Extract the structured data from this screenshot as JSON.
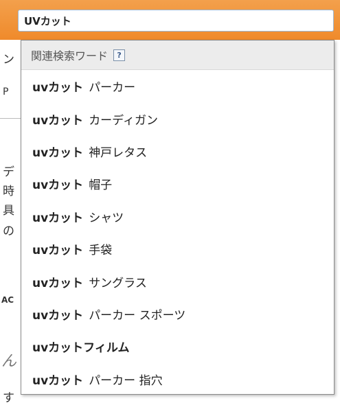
{
  "search": {
    "value": "UVカット"
  },
  "background_fragments": [
    "ン",
    "P",
    "デ",
    "時",
    "具",
    "の",
    "AC",
    "ん",
    "す"
  ],
  "dropdown": {
    "header_label": "関連検索ワード",
    "help_icon": "?",
    "items": [
      {
        "kw": "uvカット",
        "rest": "パーカー"
      },
      {
        "kw": "uvカット",
        "rest": "カーディガン"
      },
      {
        "kw": "uvカット",
        "rest": "神戸レタス"
      },
      {
        "kw": "uvカット",
        "rest": "帽子"
      },
      {
        "kw": "uvカット",
        "rest": "シャツ"
      },
      {
        "kw": "uvカット",
        "rest": "手袋"
      },
      {
        "kw": "uvカット",
        "rest": "サングラス"
      },
      {
        "kw": "uvカット",
        "rest": "パーカー スポーツ"
      },
      {
        "kw": "uvカットフィルム",
        "rest": ""
      },
      {
        "kw": "uvカット",
        "rest": "パーカー 指穴"
      }
    ]
  }
}
